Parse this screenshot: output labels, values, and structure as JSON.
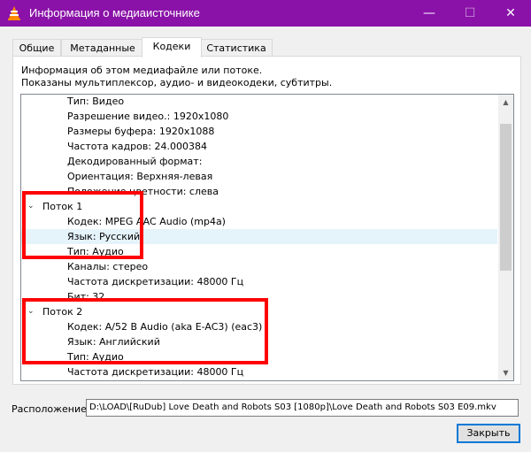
{
  "window": {
    "title": "Информация о медиаисточнике",
    "minimize_glyph": "—",
    "maximize_glyph": "☐",
    "close_glyph": "✕",
    "accent": "#8a12a8"
  },
  "tabs": [
    {
      "label": "Общие"
    },
    {
      "label": "Метаданные"
    },
    {
      "label": "Кодеки"
    },
    {
      "label": "Статистика"
    }
  ],
  "active_tab": "Кодеки",
  "info": {
    "line1": "Информация об этом медиафайле или потоке.",
    "line2": "Показаны мультиплексор, аудио- и видеокодеки, субтитры."
  },
  "tree": {
    "rows": [
      {
        "text": "Тип: Видео"
      },
      {
        "text": "Разрешение видео.: 1920x1080"
      },
      {
        "text": "Размеры буфера: 1920x1088"
      },
      {
        "text": "Частота кадров: 24.000384"
      },
      {
        "text": "Декодированный формат:"
      },
      {
        "text": "Ориентация: Верхняя-левая"
      },
      {
        "text": "Положение цветности: слева"
      },
      {
        "text": "Поток 1",
        "arrow": "⌄"
      },
      {
        "text": "Кодек: MPEG AAC Audio (mp4a)"
      },
      {
        "text": "Язык: Русский"
      },
      {
        "text": "Тип: Аудио"
      },
      {
        "text": "Каналы: стерео"
      },
      {
        "text": "Частота дискретизации: 48000 Гц"
      },
      {
        "text": "Бит: 32"
      },
      {
        "text": "Поток 2",
        "arrow": "⌄"
      },
      {
        "text": "Кодек: A/52 B Audio (aka E-AC3) (eac3)"
      },
      {
        "text": "Язык: Английский"
      },
      {
        "text": "Тип: Аудио"
      },
      {
        "text": "Частота дискретизации: 48000 Гц"
      }
    ]
  },
  "scrollbar": {
    "up_glyph": "▲",
    "down_glyph": "▼"
  },
  "location": {
    "label": "Расположение:",
    "value": "D:\\LOAD\\[RuDub] Love Death and Robots S03 [1080p]\\Love Death and Robots S03 E09.mkv"
  },
  "buttons": {
    "close_label": "Закрыть"
  },
  "annotation_color": "#ff0000"
}
